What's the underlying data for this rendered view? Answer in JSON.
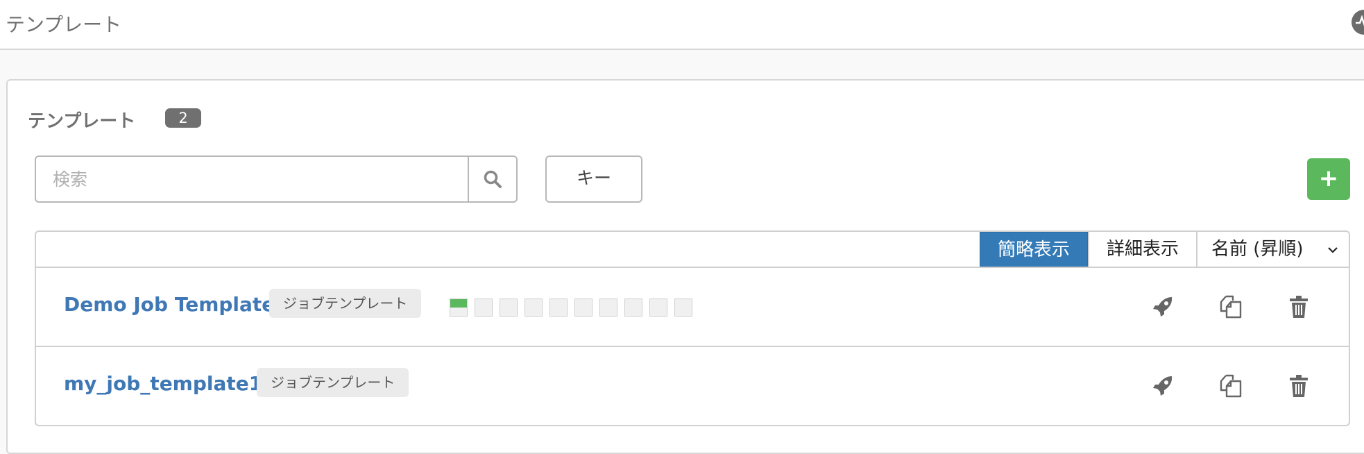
{
  "header": {
    "title": "テンプレート"
  },
  "panel": {
    "title": "テンプレート",
    "count": "2"
  },
  "search": {
    "placeholder": "検索",
    "value": "",
    "key_label": "キー",
    "add_label": "+"
  },
  "list": {
    "view_modes": [
      "簡略表示",
      "詳細表示"
    ],
    "active_view": "簡略表示",
    "sort_label": "名前 (昇順)",
    "rows": [
      {
        "name": "Demo Job Template",
        "type": "ジョブテンプレート",
        "recent_jobs": [
          "success",
          "none",
          "none",
          "none",
          "none",
          "none",
          "none",
          "none",
          "none",
          "none"
        ]
      },
      {
        "name": "my_job_template1",
        "type": "ジョブテンプレート",
        "recent_jobs": []
      }
    ],
    "actions": [
      "rocket-icon",
      "copy-icon",
      "trash-icon"
    ]
  },
  "colors": {
    "accent": "#337ab7",
    "link": "#3f78b5",
    "add_button": "#5cb85c",
    "badge": "#707070",
    "success": "#5cb85c"
  }
}
